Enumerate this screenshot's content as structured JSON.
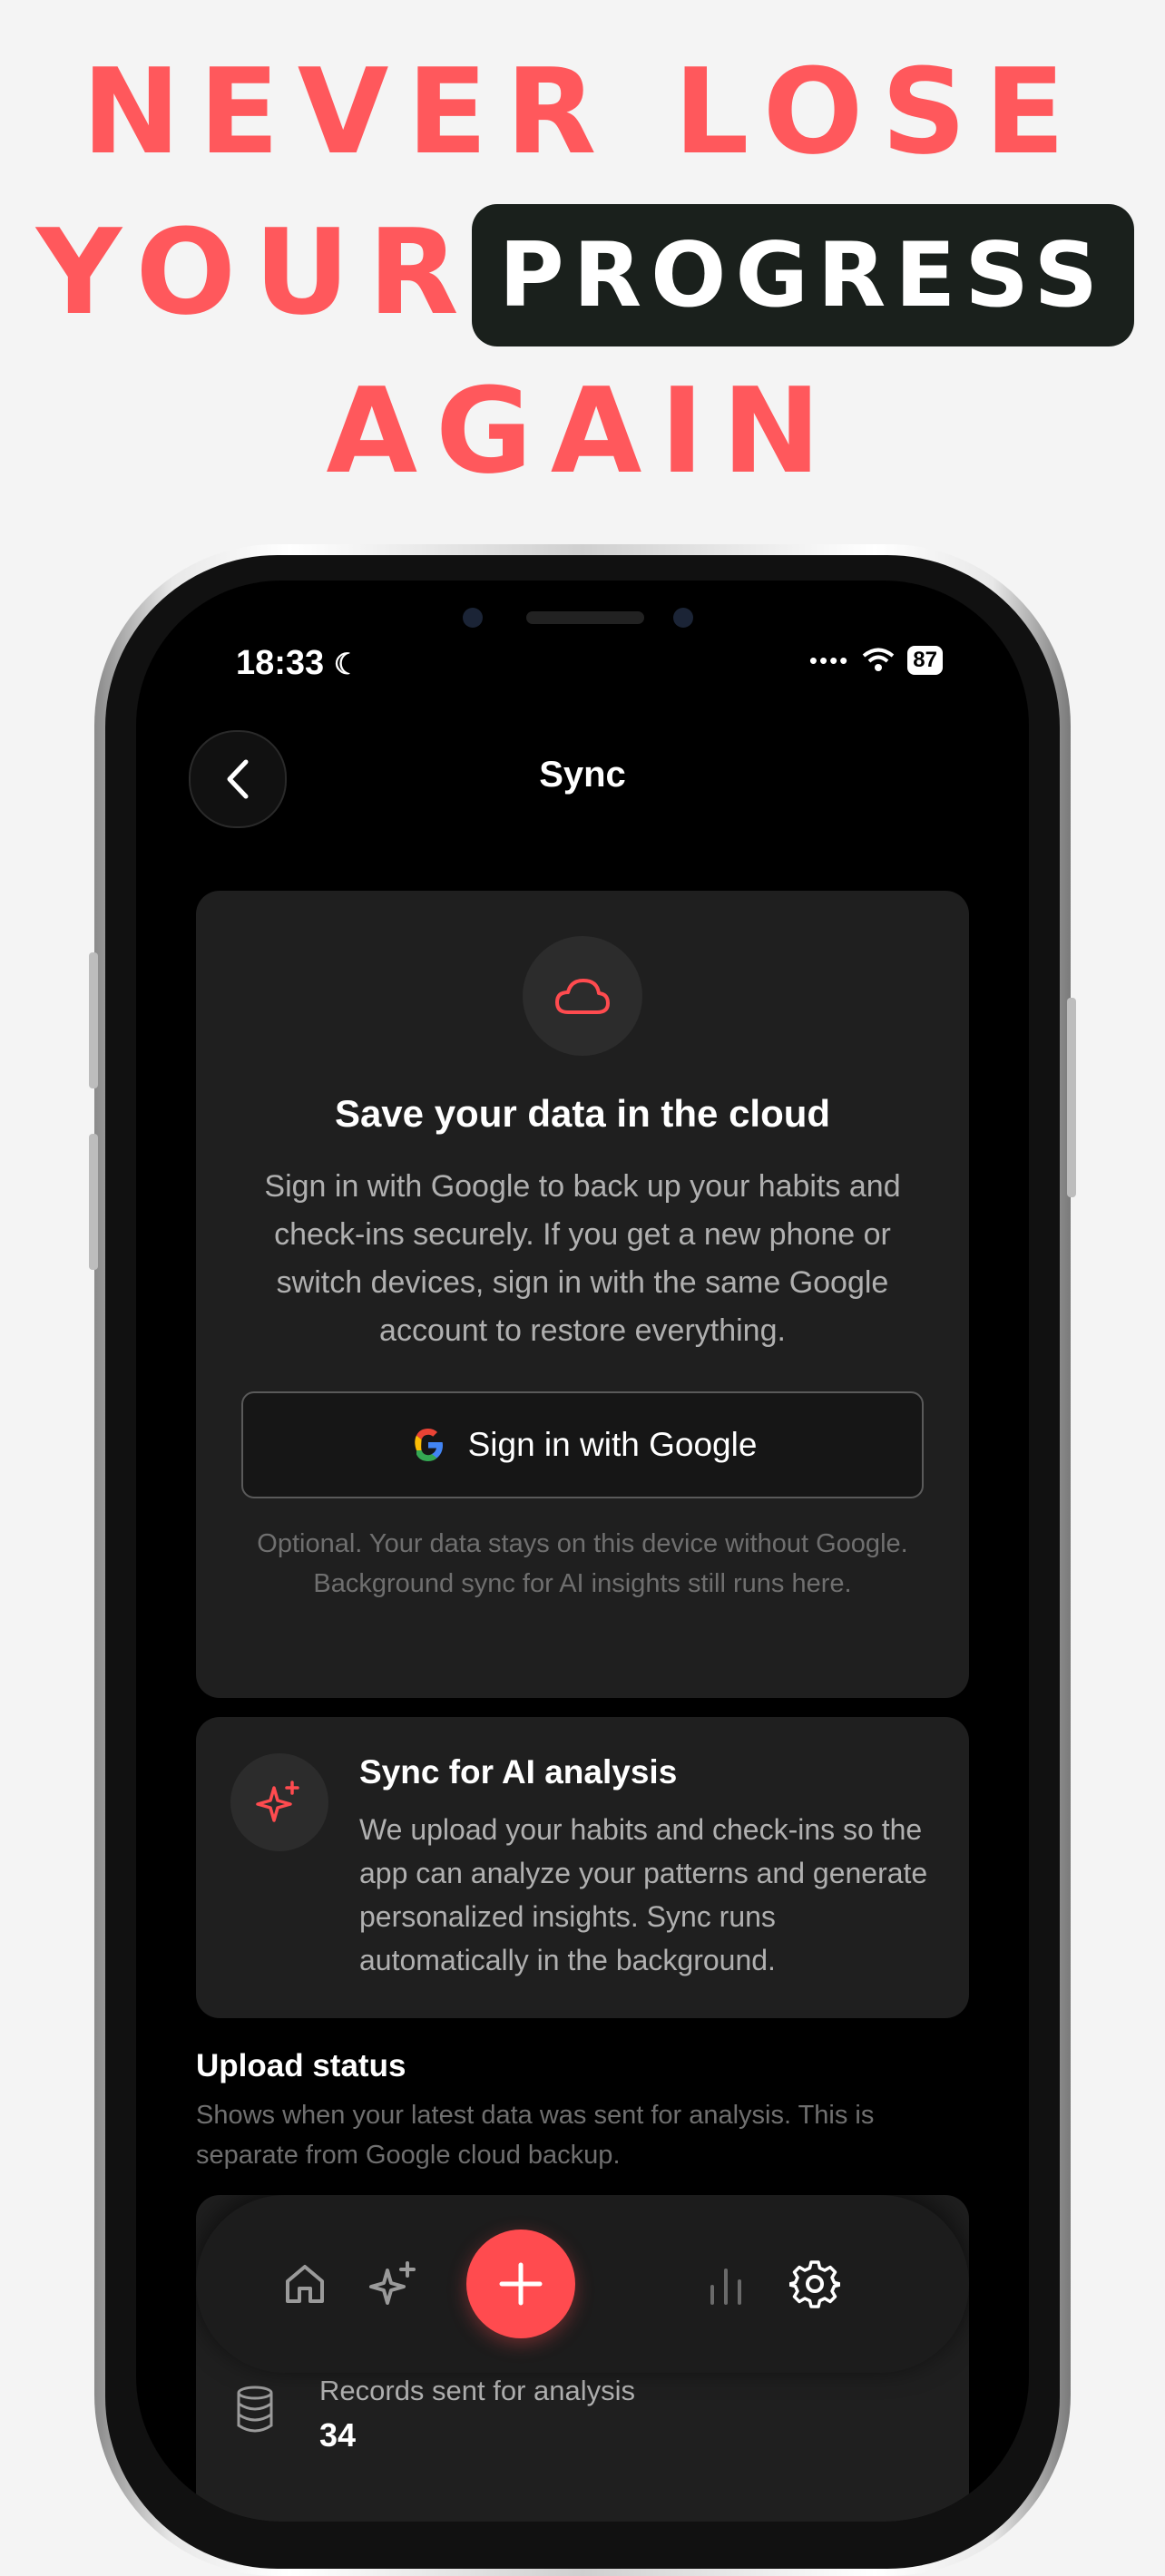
{
  "headline": {
    "line1": "NEVER LOSE",
    "line2_word": "YOUR",
    "line2_pill": "PROGRESS",
    "line3": "AGAIN"
  },
  "status_bar": {
    "time": "18:33",
    "battery": "87"
  },
  "header": {
    "title": "Sync"
  },
  "cloud_card": {
    "title": "Save your data in the cloud",
    "body": "Sign in with Google to back up your habits and check-ins securely. If you get a new phone or switch devices, sign in with the same Google account to restore everything.",
    "button_label": "Sign in with Google",
    "note": "Optional. Your data stays on this device without Google. Background sync for AI insights still runs here."
  },
  "ai_card": {
    "title": "Sync for AI analysis",
    "body": "We upload your habits and check-ins so the app can analyze your patterns and generate personalized insights. Sync runs automatically in the background."
  },
  "upload_status": {
    "title": "Upload status",
    "description": "Shows when your latest data was sent for analysis. This is separate from Google cloud backup.",
    "records_label": "Records sent for analysis",
    "records_value": "34"
  },
  "colors": {
    "accent": "#ff4b4f",
    "headline": "#ff585c",
    "card": "#1f1f1f"
  },
  "nav": {
    "items": [
      {
        "icon": "home-icon"
      },
      {
        "icon": "sparkles-icon"
      },
      {
        "icon": "plus-icon"
      },
      {
        "icon": "bar-chart-icon"
      },
      {
        "icon": "settings-gear-icon"
      }
    ]
  }
}
